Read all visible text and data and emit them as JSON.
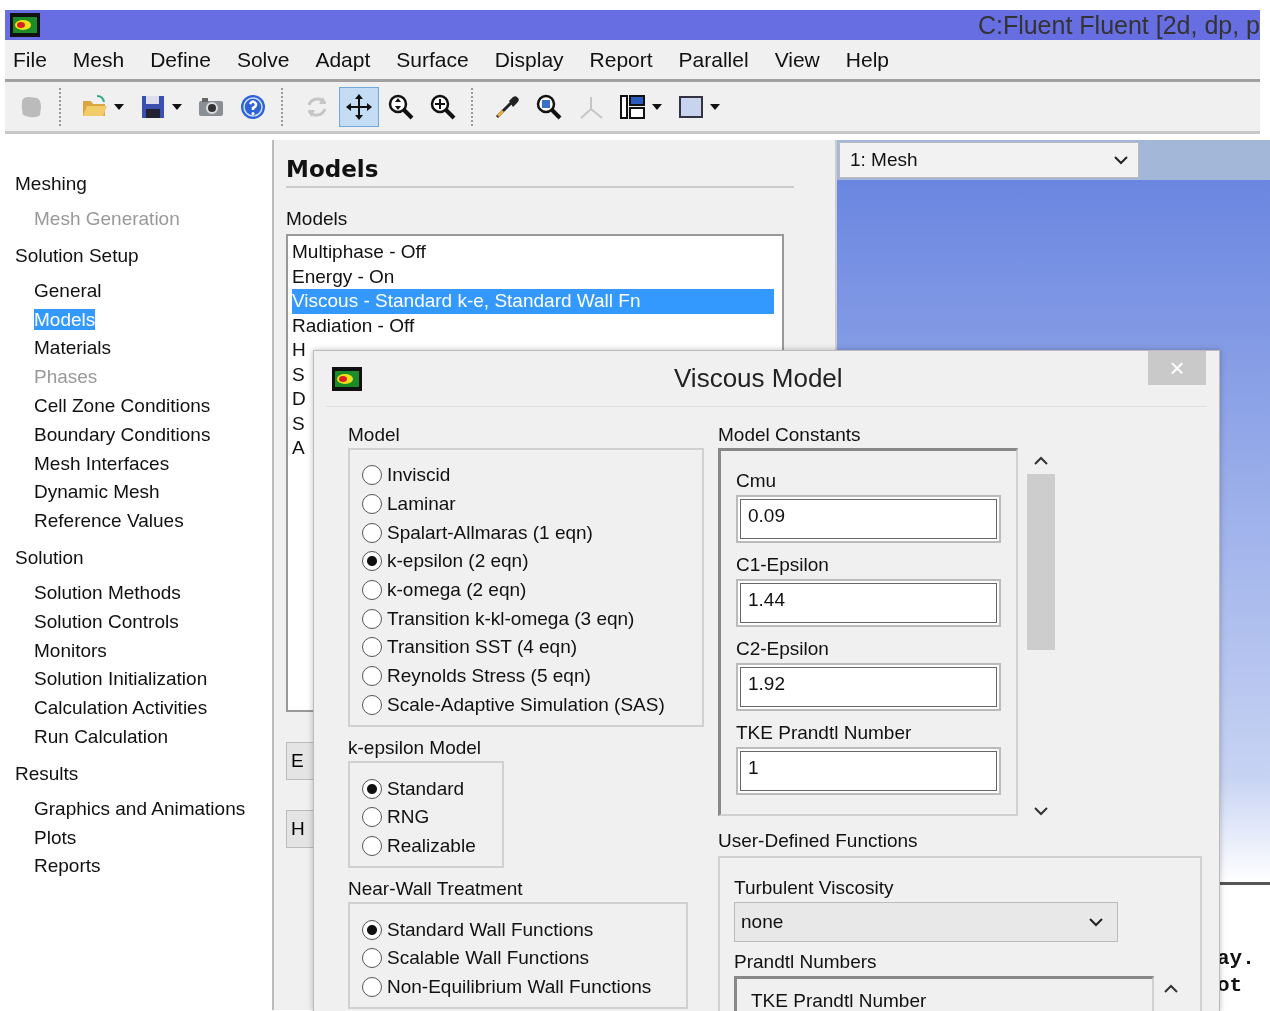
{
  "window": {
    "title": "C:Fluent Fluent  [2d, dp, p"
  },
  "menu": [
    "File",
    "Mesh",
    "Define",
    "Solve",
    "Adapt",
    "Surface",
    "Display",
    "Report",
    "Parallel",
    "View",
    "Help"
  ],
  "toolbar": [
    {
      "kind": "mesh",
      "selected": false,
      "disabled": true,
      "dropdown": false
    },
    {
      "kind": "open",
      "selected": false,
      "disabled": false,
      "dropdown": true
    },
    {
      "kind": "save",
      "selected": false,
      "disabled": false,
      "dropdown": true
    },
    {
      "kind": "camera",
      "selected": false,
      "disabled": false,
      "dropdown": false
    },
    {
      "kind": "help",
      "selected": false,
      "disabled": false,
      "dropdown": false
    },
    {
      "kind": "rotate",
      "selected": false,
      "disabled": true,
      "dropdown": false
    },
    {
      "kind": "pan",
      "selected": true,
      "disabled": false,
      "dropdown": false
    },
    {
      "kind": "zoom-fit",
      "selected": false,
      "disabled": false,
      "dropdown": false
    },
    {
      "kind": "zoom-in",
      "selected": false,
      "disabled": false,
      "dropdown": false
    },
    {
      "kind": "probe",
      "selected": false,
      "disabled": false,
      "dropdown": false
    },
    {
      "kind": "zoom-box",
      "selected": false,
      "disabled": false,
      "dropdown": false
    },
    {
      "kind": "axes",
      "selected": false,
      "disabled": true,
      "dropdown": false
    },
    {
      "kind": "layout",
      "selected": false,
      "disabled": false,
      "dropdown": true
    },
    {
      "kind": "window",
      "selected": false,
      "disabled": false,
      "dropdown": true
    }
  ],
  "sidebar": {
    "items": [
      {
        "label": "Meshing",
        "children": [
          {
            "label": "Mesh Generation",
            "selected": false,
            "disabled": true
          }
        ]
      },
      {
        "label": "Solution Setup",
        "children": [
          {
            "label": "General",
            "selected": false,
            "disabled": false
          },
          {
            "label": "Models",
            "selected": true,
            "disabled": false
          },
          {
            "label": "Materials",
            "selected": false,
            "disabled": false
          },
          {
            "label": "Phases",
            "selected": false,
            "disabled": true
          },
          {
            "label": "Cell Zone Conditions",
            "selected": false,
            "disabled": false
          },
          {
            "label": "Boundary Conditions",
            "selected": false,
            "disabled": false
          },
          {
            "label": "Mesh Interfaces",
            "selected": false,
            "disabled": false
          },
          {
            "label": "Dynamic Mesh",
            "selected": false,
            "disabled": false
          },
          {
            "label": "Reference Values",
            "selected": false,
            "disabled": false
          }
        ]
      },
      {
        "label": "Solution",
        "children": [
          {
            "label": "Solution Methods",
            "selected": false,
            "disabled": false
          },
          {
            "label": "Solution Controls",
            "selected": false,
            "disabled": false
          },
          {
            "label": "Monitors",
            "selected": false,
            "disabled": false
          },
          {
            "label": "Solution Initialization",
            "selected": false,
            "disabled": false
          },
          {
            "label": "Calculation Activities",
            "selected": false,
            "disabled": false
          },
          {
            "label": "Run Calculation",
            "selected": false,
            "disabled": false
          }
        ]
      },
      {
        "label": "Results",
        "children": [
          {
            "label": "Graphics and Animations",
            "selected": false,
            "disabled": false
          },
          {
            "label": "Plots",
            "selected": false,
            "disabled": false
          },
          {
            "label": "Reports",
            "selected": false,
            "disabled": false
          }
        ]
      }
    ]
  },
  "task_page": {
    "title": "Models",
    "list_label": "Models",
    "models": [
      {
        "label": "Multiphase - Off",
        "selected": false
      },
      {
        "label": "Energy - On",
        "selected": false
      },
      {
        "label": "Viscous - Standard k-e, Standard Wall Fn",
        "selected": true
      },
      {
        "label": "Radiation - Off",
        "selected": false
      },
      {
        "label": "H",
        "selected": false
      },
      {
        "label": "S",
        "selected": false
      },
      {
        "label": "D",
        "selected": false
      },
      {
        "label": "S",
        "selected": false
      },
      {
        "label": "A",
        "selected": false
      }
    ],
    "buttons": [
      "E",
      "H"
    ]
  },
  "graphics": {
    "view_select": "1: Mesh",
    "console_lines": [
      "ay.",
      "ot"
    ]
  },
  "dialog": {
    "title": "Viscous Model",
    "close": "×",
    "model": {
      "label": "Model",
      "options": [
        {
          "label": "Inviscid",
          "selected": false
        },
        {
          "label": "Laminar",
          "selected": false
        },
        {
          "label": "Spalart-Allmaras (1 eqn)",
          "selected": false
        },
        {
          "label": "k-epsilon (2 eqn)",
          "selected": true
        },
        {
          "label": "k-omega (2 eqn)",
          "selected": false
        },
        {
          "label": "Transition k-kl-omega (3 eqn)",
          "selected": false
        },
        {
          "label": "Transition SST (4 eqn)",
          "selected": false
        },
        {
          "label": "Reynolds Stress (5 eqn)",
          "selected": false
        },
        {
          "label": "Scale-Adaptive Simulation (SAS)",
          "selected": false
        }
      ]
    },
    "k_epsilon_model": {
      "label": "k-epsilon Model",
      "options": [
        {
          "label": "Standard",
          "selected": true
        },
        {
          "label": "RNG",
          "selected": false
        },
        {
          "label": "Realizable",
          "selected": false
        }
      ]
    },
    "near_wall_treatment": {
      "label": "Near-Wall Treatment",
      "options": [
        {
          "label": "Standard Wall Functions",
          "selected": true
        },
        {
          "label": "Scalable Wall Functions",
          "selected": false
        },
        {
          "label": "Non-Equilibrium Wall Functions",
          "selected": false
        }
      ]
    },
    "model_constants": {
      "label": "Model Constants",
      "fields": [
        {
          "label": "Cmu",
          "value": "0.09"
        },
        {
          "label": "C1-Epsilon",
          "value": "1.44"
        },
        {
          "label": "C2-Epsilon",
          "value": "1.92"
        },
        {
          "label": "TKE Prandtl Number",
          "value": "1"
        }
      ]
    },
    "user_defined_functions": {
      "label": "User-Defined Functions",
      "turbulent_viscosity_label": "Turbulent Viscosity",
      "turbulent_viscosity": "none",
      "prandtl_label": "Prandtl Numbers",
      "prandtl_fields": [
        "TKE Prandtl Number"
      ]
    }
  }
}
